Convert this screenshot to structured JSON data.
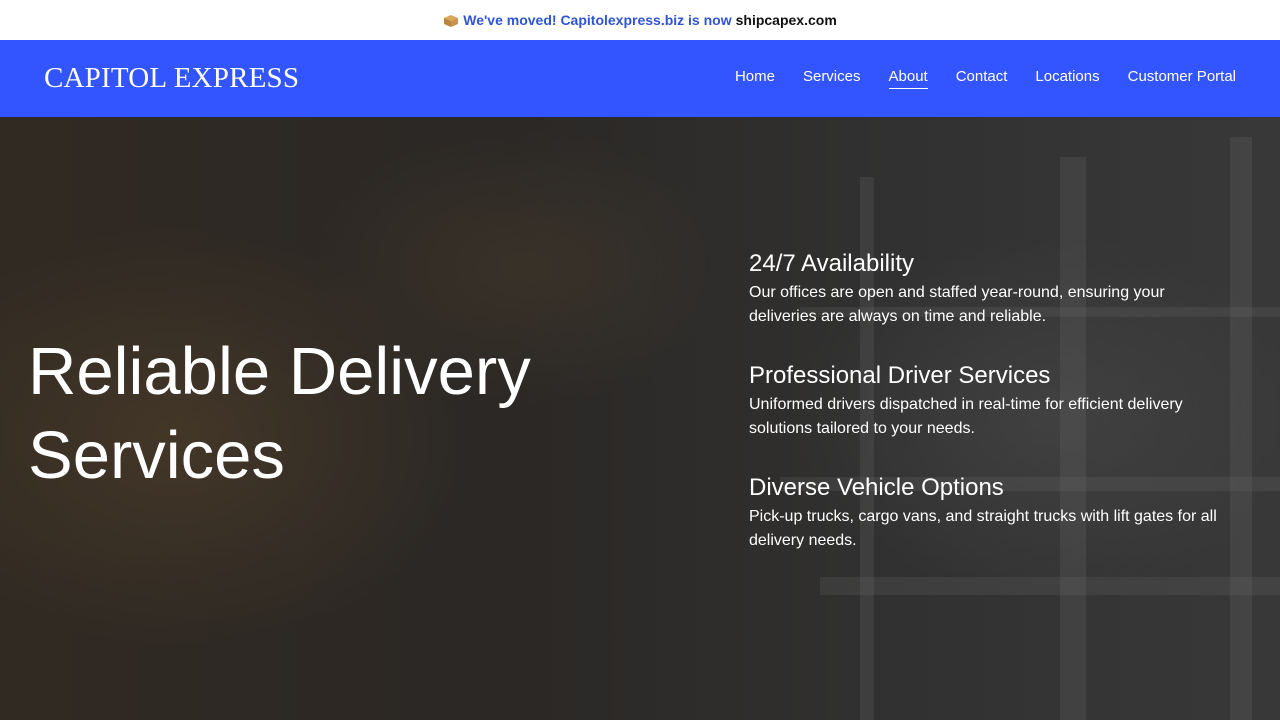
{
  "announcement": {
    "icon": "package-icon",
    "lead": "We've moved! Capitolexpress.biz is now",
    "domain": "shipcapex.com"
  },
  "header": {
    "brand": "CAPITOL EXPRESS",
    "nav": [
      {
        "label": "Home",
        "active": false
      },
      {
        "label": "Services",
        "active": false
      },
      {
        "label": "About",
        "active": true
      },
      {
        "label": "Contact",
        "active": false
      },
      {
        "label": "Locations",
        "active": false
      },
      {
        "label": "Customer Portal",
        "active": false
      }
    ],
    "accent_color": "#3355ff"
  },
  "hero": {
    "headline": "Reliable Delivery Services",
    "features": [
      {
        "title": "24/7 Availability",
        "text": "Our offices are open and staffed year-round, ensuring your deliveries are always on time and reliable."
      },
      {
        "title": "Professional Driver Services",
        "text": "Uniformed drivers dispatched in real-time for efficient delivery solutions tailored to your needs."
      },
      {
        "title": "Diverse Vehicle Options",
        "text": "Pick-up trucks, cargo vans, and straight trucks with lift gates for all delivery needs."
      }
    ]
  }
}
